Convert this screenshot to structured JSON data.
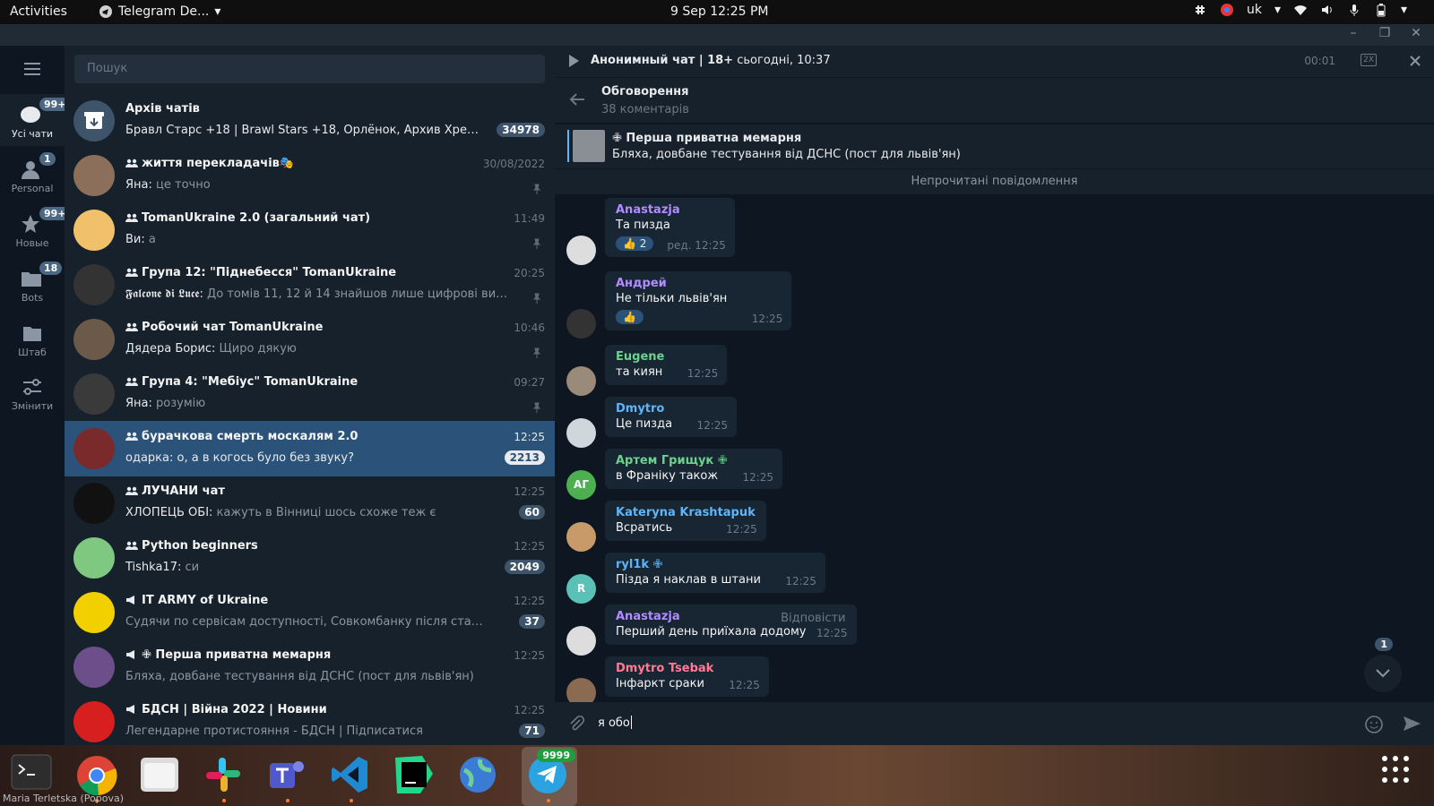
{
  "topbar": {
    "activities": "Activities",
    "app_name": "Telegram De...",
    "clock": "9 Sep  12:25 PM",
    "lang": "uk"
  },
  "rail": {
    "items": [
      {
        "label": "Усі чати",
        "badge": "99+"
      },
      {
        "label": "Personal",
        "badge": "1"
      },
      {
        "label": "Новые",
        "badge": "99+"
      },
      {
        "label": "Bots",
        "badge": "18"
      },
      {
        "label": "Штаб",
        "badge": ""
      },
      {
        "label": "Змінити",
        "badge": ""
      }
    ]
  },
  "sidebar": {
    "search_placeholder": "Пошук",
    "chats": [
      {
        "name": "Архів чатів",
        "time": "",
        "sender": "",
        "preview": "Бравл Старс +18 | Brawl Stars +18, Орлёнок, Архив Хреста 🗡, Ja...",
        "count": "34978",
        "pinned": false,
        "type": "archive"
      },
      {
        "name": "життя перекладачів🎭",
        "time": "30/08/2022",
        "sender": "Яна: ",
        "preview": "це точно",
        "count": "",
        "pinned": true,
        "type": "group"
      },
      {
        "name": "TomanUkraine 2.0 (загальний чат)",
        "time": "11:49",
        "sender": "Ви: ",
        "preview": "а",
        "count": "",
        "pinned": true,
        "type": "group"
      },
      {
        "name": "Група 12: \"Піднебесся\" TomanUkraine",
        "time": "20:25",
        "sender": "𝕱𝖆𝖑𝖈𝖔𝖓𝖊 𝖉𝖎 𝕷𝖚𝖈𝖊: ",
        "preview": "До томів 11, 12 й 14 знайшов лише цифрові видання,...",
        "count": "",
        "pinned": true,
        "type": "group"
      },
      {
        "name": "Робочий чат TomanUkraine",
        "time": "10:46",
        "sender": "Дядера Борис: ",
        "preview": "Щиро дякую",
        "count": "",
        "pinned": true,
        "type": "group"
      },
      {
        "name": "Група 4: \"Мебіус\" TomanUkraine",
        "time": "09:27",
        "sender": "Яна: ",
        "preview": "розумію",
        "count": "",
        "pinned": true,
        "type": "group"
      },
      {
        "name": "бурачкова смерть москалям 2.0",
        "time": "12:25",
        "sender": "одарка: ",
        "preview": "о, а в когось було без звуку?",
        "count": "2213",
        "pinned": false,
        "type": "group"
      },
      {
        "name": "ЛУЧАНИ чат",
        "time": "12:25",
        "sender": "ХЛОПЕЦЬ ОБІ: ",
        "preview": "кажуть в Вінниці шось схоже теж є",
        "count": "60",
        "pinned": false,
        "type": "group"
      },
      {
        "name": "Python beginners",
        "time": "12:25",
        "sender": "Tishka17: ",
        "preview": "си",
        "count": "2049",
        "pinned": false,
        "type": "group"
      },
      {
        "name": "IT ARMY of Ukraine",
        "time": "12:25",
        "sender": "",
        "preview": "Судячи по сервісам доступності, Совкомбанку після старту...",
        "count": "37",
        "pinned": false,
        "type": "channel"
      },
      {
        "name": "✙ Перша приватна мемарня",
        "time": "12:25",
        "sender": "",
        "preview": "Бляха, довбане тестування від ДСНС   (пост для львів'ян)",
        "count": "",
        "pinned": false,
        "type": "channel"
      },
      {
        "name": "БДСН | Війна 2022 | Новини",
        "time": "12:25",
        "sender": "",
        "preview": "Легендарне протистояння - БДСН | Підписатися",
        "count": "71",
        "pinned": false,
        "type": "channel"
      }
    ]
  },
  "player": {
    "title": "Анонимный чат | 18+",
    "subtitle": " сьогодні, 10:37",
    "duration": "00:01",
    "speed": "2X"
  },
  "thread": {
    "title": "Обговорення",
    "subtitle": "38 коментарів"
  },
  "pinned": {
    "title": "✙ Перша приватна мемарня",
    "text": "Бляха, довбане тестування від ДСНС   (пост для львів'ян)"
  },
  "unread_label": "Непрочитані повідомлення",
  "messages": [
    {
      "author": "Anastazja",
      "color": "#b18cfe",
      "text": "Та пизда",
      "time": "ред. 12:25",
      "reaction": "👍 2",
      "reply": ""
    },
    {
      "author": "Андрей",
      "color": "#b18cfe",
      "text": "Не тільки львів'ян",
      "time": "12:25",
      "reaction": "👍",
      "reply": ""
    },
    {
      "author": "Eugene",
      "color": "#6cd28d",
      "text": "та киян",
      "time": "12:25",
      "reaction": "",
      "reply": ""
    },
    {
      "author": "Dmytro",
      "color": "#5eb5f7",
      "text": "Це пизда",
      "time": "12:25",
      "reaction": "",
      "reply": ""
    },
    {
      "author": "Артем Грищук ✙",
      "color": "#6cd28d",
      "text": "в Франіку також",
      "time": "12:25",
      "reaction": "",
      "reply": ""
    },
    {
      "author": "Kateryna Krashtapuk",
      "color": "#5eb5f7",
      "text": "Всратись",
      "time": "12:25",
      "reaction": "",
      "reply": ""
    },
    {
      "author": "ryl1k ✙",
      "color": "#5eb5f7",
      "text": "Пізда я наклав в штани",
      "time": "12:25",
      "reaction": "",
      "reply": ""
    },
    {
      "author": "Anastazja",
      "color": "#b18cfe",
      "text": "Перший день приїхала додому",
      "time": "12:25",
      "reaction": "",
      "reply": "Відповісти"
    },
    {
      "author": "Dmytro Tsebak",
      "color": "#ff7b93",
      "text": "Інфаркт сраки",
      "time": "12:25",
      "reaction": "",
      "reply": ""
    }
  ],
  "avatars": {
    "artem": "АГ",
    "ryl1k": "R"
  },
  "scroll_badge": "1",
  "composer": {
    "text": "я обо"
  },
  "dock": {
    "telegram_badge": "9999",
    "caption": "Maria Terletska (Popova)"
  },
  "colors": {
    "accent": "#2b5278",
    "link": "#5eb5f7",
    "bg_dark": "#0e1621",
    "bg_panel": "#17212b"
  }
}
